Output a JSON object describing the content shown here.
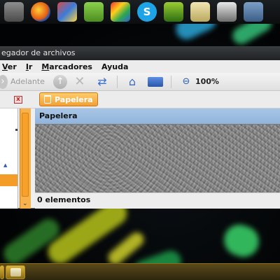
{
  "top_panel": {
    "launchers": [
      "generic-app-icon",
      "firefox-icon",
      "paint-icon",
      "android-icon",
      "gem-icon",
      "skype-icon",
      "nvidia-icon",
      "folder-icon",
      "phone-icon",
      "lock-icon"
    ],
    "skype_glyph": "S"
  },
  "window": {
    "title": "egador de archivos",
    "menu": [
      {
        "mnemonic": "V",
        "rest": "er"
      },
      {
        "mnemonic": "I",
        "rest": "r"
      },
      {
        "mnemonic": "M",
        "rest": "arcadores"
      },
      {
        "mnemonic": "",
        "rest": "Ayuda"
      }
    ],
    "toolbar": {
      "forward_label": "Adelante",
      "zoom_level": "100%"
    },
    "location": {
      "close_glyph": "x",
      "path_button": "Papelera"
    },
    "content": {
      "header": "Papelera",
      "status": "0 elementos"
    }
  },
  "colors": {
    "accent": "#f1a037",
    "header_blue": "#a8c6e6"
  }
}
